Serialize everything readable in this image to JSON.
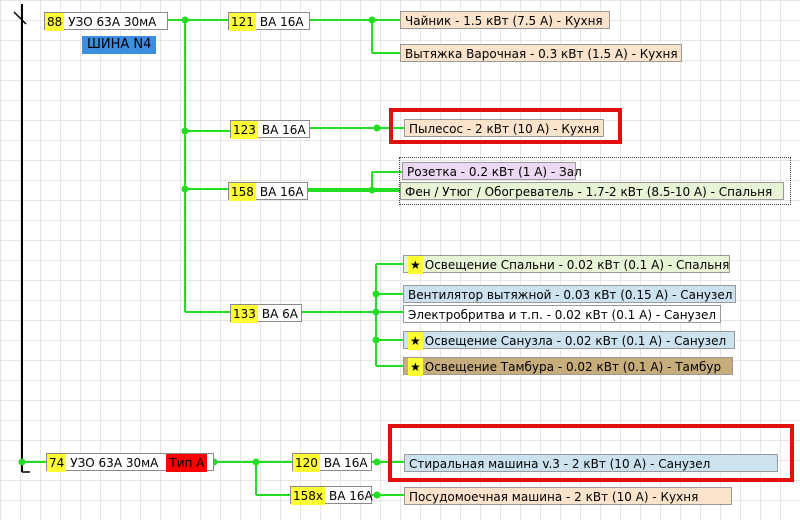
{
  "colors": {
    "wire": "#22dd22",
    "number_bg": "#ffff33",
    "type_tag": "#ff0000",
    "bus_label_bg": "#3b8ee0",
    "highlight": "#e01010"
  },
  "rcd1": {
    "num": "88",
    "label": "УЗО 63А 30мА"
  },
  "bus_label": "ШИНА  N4",
  "breakers": [
    {
      "num": "121",
      "label": "ВА 16А"
    },
    {
      "num": "123",
      "label": "ВА 16А"
    },
    {
      "num": "158",
      "label": "ВА 16А"
    },
    {
      "num": "133",
      "label": "ВА 6А"
    },
    {
      "num": "120",
      "label": "ВА 16А"
    },
    {
      "num": "158х",
      "label": "ВА 16А"
    }
  ],
  "rcd2": {
    "num": "74",
    "label": "УЗО 63А 30мА",
    "tag": "Тип А"
  },
  "loads": [
    {
      "text": "Чайник - 1.5 кВт (7.5 А) - Кухня"
    },
    {
      "text": "Вытяжка Варочная - 0.3 кВт (1.5 А) - Кухня"
    },
    {
      "text": "Пылесос - 2 кВт (10 А) - Кухня"
    },
    {
      "text": "Розетка - 0.2 кВт (1 А) - Зал"
    },
    {
      "text": "Фен / Утюг / Обогреватель - 1.7-2 кВт (8.5-10 А) - Спальня"
    },
    {
      "text": "Освещение Спальни - 0.02 кВт (0.1 А) - Спальня",
      "star": "★"
    },
    {
      "text": "Вентилятор вытяжной - 0.03 кВт (0.15 А) - Санузел"
    },
    {
      "text": "Электробритва и т.п. - 0.02 кВт (0.1 А) - Санузел"
    },
    {
      "text": "Освещение Санузла - 0.02 кВт (0.1 А) - Санузел",
      "star": "★"
    },
    {
      "text": "Освещение Тамбура - 0.02 кВт (0.1 А) - Тамбур",
      "star": "★"
    },
    {
      "text": "Стиральная машина v.3 - 2 кВт (10 А) - Санузел"
    },
    {
      "text": "Посудомоечная машина - 2 кВт (10 А) - Кухня"
    }
  ]
}
